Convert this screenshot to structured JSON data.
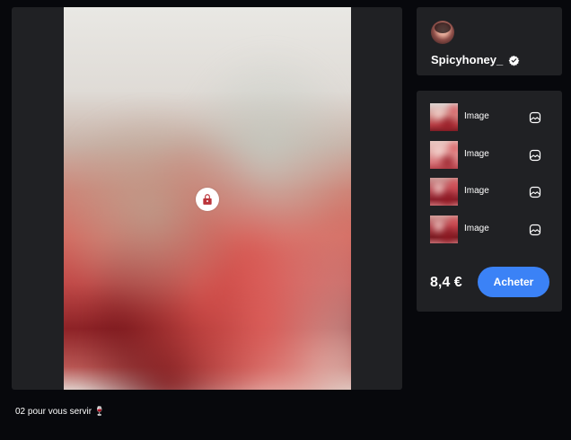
{
  "media": {
    "caption": "02 pour vous servir 🍷",
    "locked_icon": "lock-icon"
  },
  "profile": {
    "username": "Spicyhoney_",
    "verified_icon": "verified-badge-icon",
    "avatar_icon": "avatar"
  },
  "purchase": {
    "items": [
      {
        "label": "Image",
        "icon": "image-icon"
      },
      {
        "label": "Image",
        "icon": "image-icon"
      },
      {
        "label": "Image",
        "icon": "image-icon"
      },
      {
        "label": "Image",
        "icon": "image-icon"
      }
    ],
    "price": "8,4 €",
    "buy_label": "Acheter"
  },
  "colors": {
    "background": "#07080c",
    "card": "#202124",
    "accent": "#3b82f6",
    "text": "#ffffff"
  }
}
